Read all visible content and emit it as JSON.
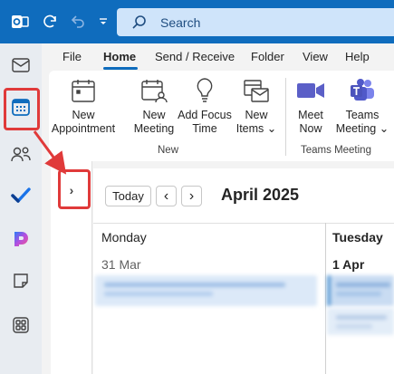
{
  "search": {
    "placeholder": "Search"
  },
  "tabs": [
    {
      "label": "File"
    },
    {
      "label": "Home"
    },
    {
      "label": "Send / Receive"
    },
    {
      "label": "Folder"
    },
    {
      "label": "View"
    },
    {
      "label": "Help"
    }
  ],
  "ribbon": {
    "new_appointment": "New\nAppointment",
    "new_meeting": "New\nMeeting",
    "add_focus_time": "Add Focus\nTime",
    "new_items": "New\nItems ⌄",
    "meet_now": "Meet\nNow",
    "teams_meeting": "Teams\nMeeting ⌄",
    "group_new": "New",
    "group_teams": "Teams Meeting"
  },
  "calendar": {
    "today_label": "Today",
    "prev_icon": "‹",
    "next_icon": "›",
    "expand_icon": "›",
    "month_title": "April 2025",
    "days": [
      {
        "name": "Monday",
        "date": "31 Mar"
      },
      {
        "name": "Tuesday",
        "date": "1 Apr"
      }
    ]
  },
  "colors": {
    "brand": "#0f6cbd",
    "highlight": "#e03a3a",
    "event_fill": "#dce9f8",
    "event_bar": "#5b9bd5"
  },
  "icons": {
    "outlook": "outlook-icon",
    "sync": "sync-icon",
    "undo": "undo-icon",
    "dropdown": "dropdown-icon",
    "mail": "mail-icon",
    "calendar": "calendar-icon",
    "people": "people-icon",
    "todo": "todo-icon",
    "copilot": "copilot-icon",
    "notes": "notes-icon",
    "apps": "apps-icon"
  }
}
